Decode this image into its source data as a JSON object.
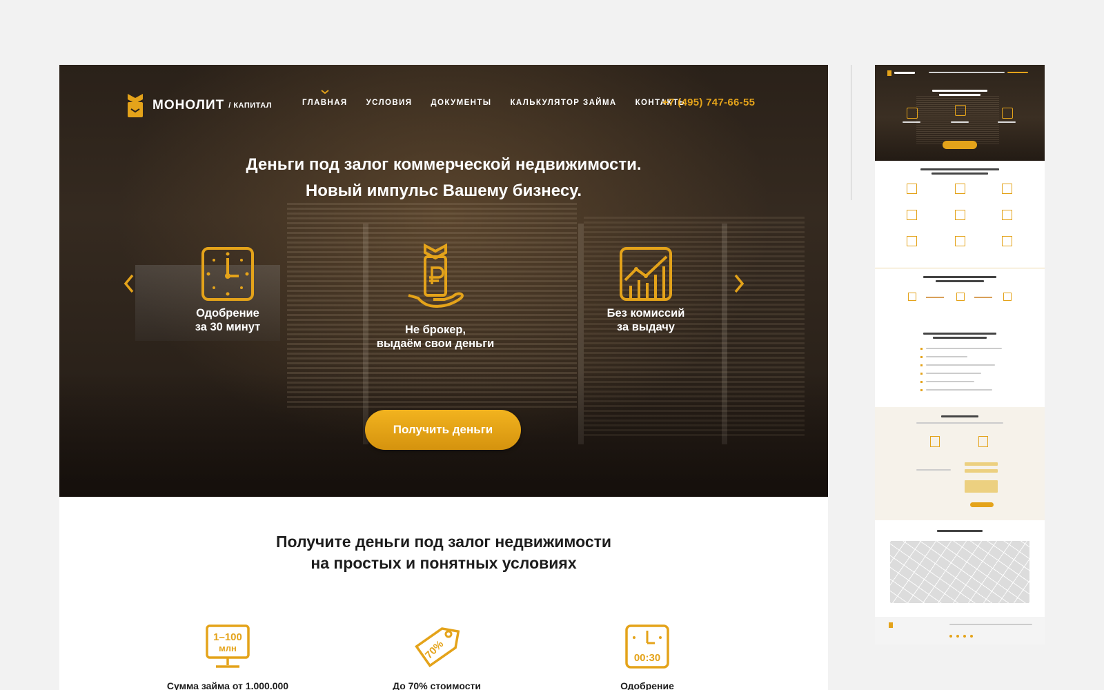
{
  "brand": {
    "name": "МОНОЛИТ",
    "suffix": "/ КАПИТАЛ",
    "accent_color": "#e4a31a"
  },
  "nav": {
    "items": [
      "ГЛАВНАЯ",
      "УСЛОВИЯ",
      "ДОКУМЕНТЫ",
      "КАЛЬКУЛЯТОР ЗАЙМА",
      "КОНТАКТЫ"
    ],
    "active": "ГЛАВНАЯ",
    "phone": "+7 (495) 747-66-55"
  },
  "hero": {
    "title_line1": "Деньги под залог коммерческой недвижимости.",
    "title_line2": "Новый импульс Вашему бизнесу.",
    "features": [
      {
        "icon": "clock-icon",
        "label": "Одобрение\nза 30 минут"
      },
      {
        "icon": "ruble-hand-icon",
        "label": "Не брокер,\nвыдаём свои деньги"
      },
      {
        "icon": "growth-chart-icon",
        "label": "Без комиссий\nза выдачу"
      }
    ],
    "cta_label": "Получить деньги",
    "prev_arrow": "‹",
    "next_arrow": "›"
  },
  "conditions": {
    "title_line1": "Получите деньги под залог недвижимости",
    "title_line2": "на простых и понятных условиях",
    "items": [
      {
        "icon": "amount-monitor-icon",
        "icon_text1": "1–100",
        "icon_text2": "млн",
        "label": "Сумма займа от 1.000.000"
      },
      {
        "icon": "percent-tag-icon",
        "icon_text1": "70%",
        "label": "До 70% стоимости"
      },
      {
        "icon": "timer-icon",
        "icon_text1": "00:30",
        "label": "Одобрение"
      }
    ]
  }
}
